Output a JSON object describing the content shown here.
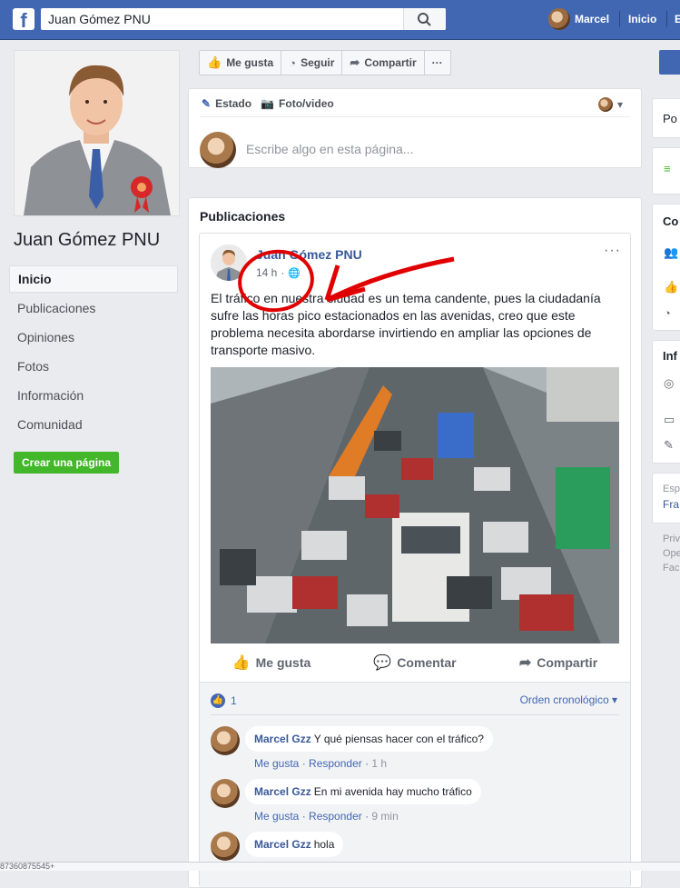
{
  "topbar": {
    "logo": "f",
    "search_value": "Juan Gómez PNU",
    "user_name": "Marcel",
    "home_label": "Inicio",
    "extra_label": "E"
  },
  "page": {
    "name": "Juan Gómez PNU",
    "nav": [
      {
        "label": "Inicio",
        "active": true
      },
      {
        "label": "Publicaciones"
      },
      {
        "label": "Opiniones"
      },
      {
        "label": "Fotos"
      },
      {
        "label": "Información"
      },
      {
        "label": "Comunidad"
      }
    ],
    "create_page_label": "Crear una página"
  },
  "actions": {
    "like": "Me gusta",
    "follow": "Seguir",
    "share": "Compartir",
    "more": "···"
  },
  "composer": {
    "tab_status": "Estado",
    "tab_photo": "Foto/video",
    "placeholder": "Escribe algo en esta página..."
  },
  "publications": {
    "title": "Publicaciones",
    "post": {
      "author": "Juan Gómez PNU",
      "time": "14 h",
      "text": "El tráfico en nuestra ciudad es un tema candente, pues la ciudadanía sufre las horas pico estacionados en las avenidas, creo que este problema necesita abordarse invirtiendo en ampliar las opciones de transporte masivo.",
      "actions": {
        "like": "Me gusta",
        "comment": "Comentar",
        "share": "Compartir"
      },
      "like_count": "1",
      "order": "Orden cronológico",
      "comments": [
        {
          "name": "Marcel Gzz",
          "text": "Y qué piensas hacer con el tráfico?",
          "like": "Me gusta",
          "reply": "Responder",
          "time": "1 h"
        },
        {
          "name": "Marcel Gzz",
          "text": "En mi avenida hay mucho tráfico",
          "like": "Me gusta",
          "reply": "Responder",
          "time": "9 min"
        },
        {
          "name": "Marcel Gzz",
          "text": "hola"
        }
      ]
    }
  },
  "right": {
    "card1": "Po",
    "card3_title": "Co",
    "card4_title": "Inf",
    "card5_a": "Esp",
    "card5_b": "Fra",
    "footer": [
      "Priv",
      "Ope",
      "Fac"
    ]
  },
  "status_bar": "87360875545+"
}
